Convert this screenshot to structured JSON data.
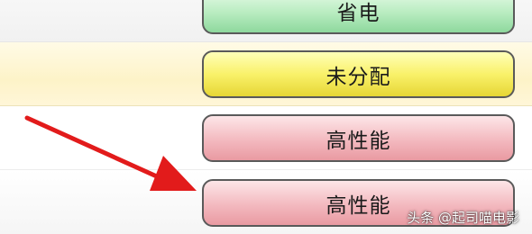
{
  "options": [
    {
      "label": "省电",
      "color": "#b8ecc0"
    },
    {
      "label": "未分配",
      "color": "#f9f16a"
    },
    {
      "label": "高性能",
      "color": "#f3b9bf"
    },
    {
      "label": "高性能",
      "color": "#f3b9bf"
    }
  ],
  "annotation": {
    "icon": "red-arrow-icon",
    "color": "#e21b1b"
  },
  "watermark": {
    "text": "头条 @起司喵电影"
  }
}
